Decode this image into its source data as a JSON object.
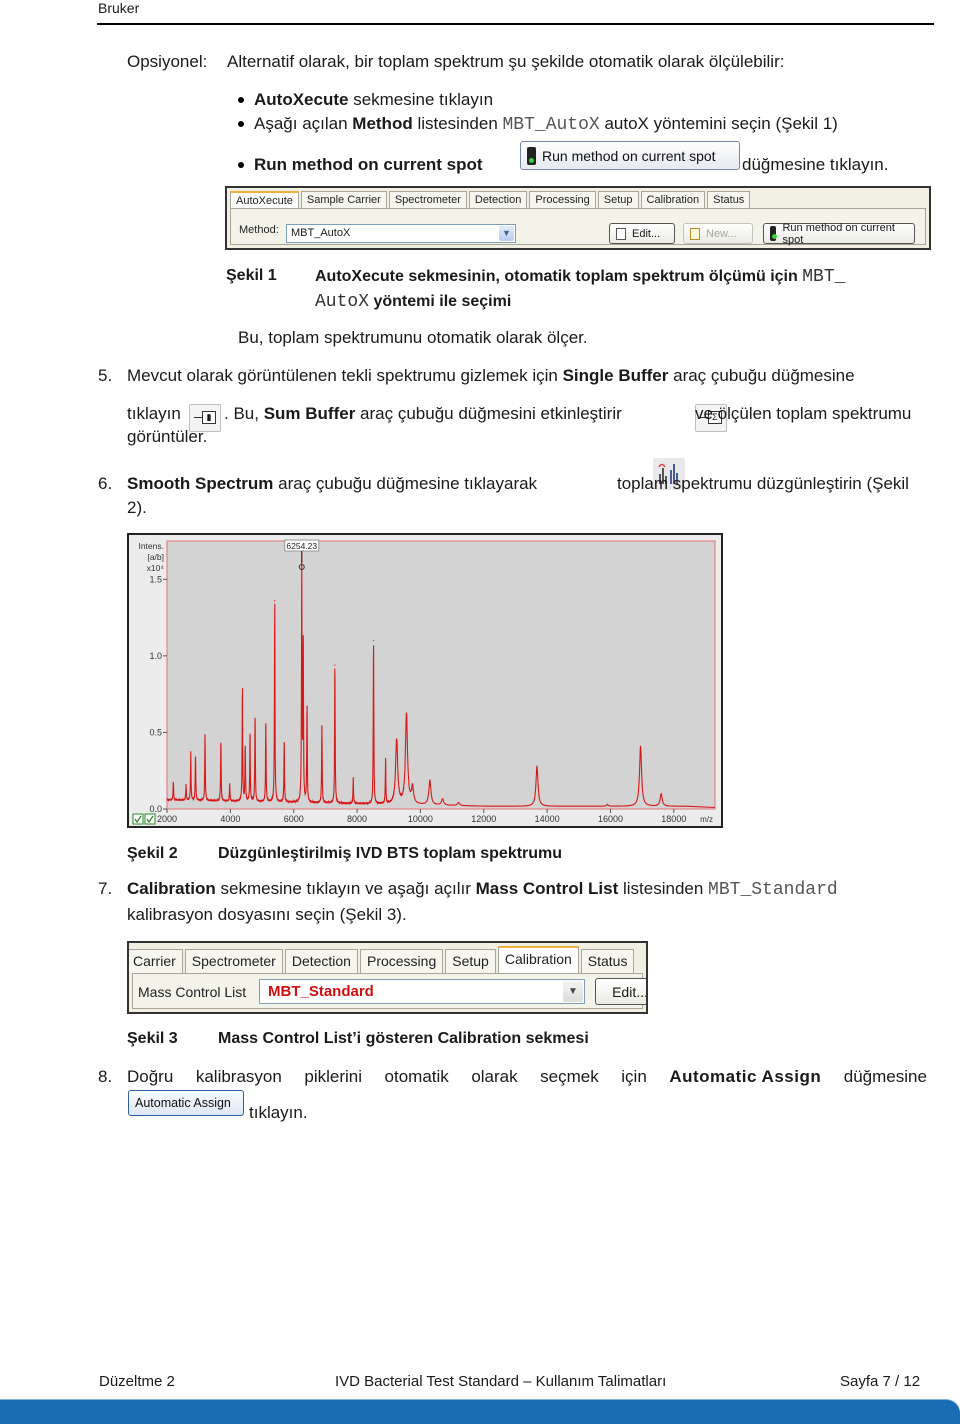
{
  "header": {
    "brand": "Bruker"
  },
  "optional": {
    "label": "Opsiyonel:",
    "text": "Alternatif olarak, bir toplam spektrum şu şekilde otomatik olarak ölçülebilir:",
    "bullets": [
      {
        "bold": "AutoXecute",
        "rest": " sekmesine tıklayın"
      },
      {
        "pre": "Aşağı açılan ",
        "bold": "Method",
        "mid": " listesinden ",
        "code": "MBT_AutoX",
        "rest": " autoX yöntemini seçin (Şekil 1)"
      },
      {
        "bold": "Run method on current spot",
        "button_label": "Run method on current spot",
        "rest": " düğmesine tıklayın."
      }
    ]
  },
  "figure1": {
    "tabs": [
      "AutoXecute",
      "Sample Carrier",
      "Spectrometer",
      "Detection",
      "Processing",
      "Setup",
      "Calibration",
      "Status"
    ],
    "active_tab": "AutoXecute",
    "method_label": "Method:",
    "method_value": "MBT_AutoX",
    "edit_button": "Edit...",
    "new_button": "New...",
    "run_button": "Run method on current spot",
    "caption_num": "Şekil 1",
    "caption_text_1": "AutoXecute sekmesinin, otomatik toplam spektrum ölçümü için ",
    "caption_code_1": "MBT_",
    "caption_code_2": "AutoX",
    "caption_text_2": " yöntemi ile seçimi"
  },
  "after_fig1": "Bu, toplam spektrumunu otomatik olarak ölçer.",
  "step5": {
    "num": "5.",
    "t1": "Mevcut olarak görüntülenen tekli spektrumu gizlemek için ",
    "b1": "Single Buffer",
    "t2": " araç çubuğu düğmesine",
    "t3": "tıklayın",
    "t4": ". Bu, ",
    "b2": "Sum Buffer",
    "t5": " araç çubuğu düğmesini etkinleştirir",
    "t6": "ve ölçülen toplam spektrumu",
    "t7": "görüntüler.",
    "icon_single": "single-buffer-icon",
    "icon_sum": "sum-buffer-icon"
  },
  "step6": {
    "num": "6.",
    "b1": "Smooth Spectrum",
    "t1": " araç çubuğu düğmesine tıklayarak",
    "t2": "toplam spektrumu düzgünleştirin (Şekil",
    "t3": "2).",
    "icon": "smooth-spectrum-icon"
  },
  "chart_data": {
    "type": "line",
    "title": "",
    "xlabel": "m/z",
    "ylabel": "Intens. [a/b] x10^4",
    "ylabel_lines": [
      "Intens.",
      "[a/b]",
      "x10⁴"
    ],
    "xlim": [
      2000,
      19300
    ],
    "ylim": [
      0,
      1.75
    ],
    "x_ticks": [
      2000,
      4000,
      6000,
      8000,
      10000,
      12000,
      14000,
      16000,
      18000
    ],
    "y_ticks": [
      "0.0",
      "0.5",
      "1.0",
      "1.5"
    ],
    "y_tick_values": [
      0,
      0.5,
      1.0,
      1.5
    ],
    "grid": false,
    "peak_annotation": {
      "x": 6254.23,
      "label": "6254.23"
    },
    "baseline": 0.05,
    "peaks": [
      {
        "x": 2200,
        "y": 0.14
      },
      {
        "x": 2600,
        "y": 0.12
      },
      {
        "x": 2750,
        "y": 0.34
      },
      {
        "x": 2900,
        "y": 0.31
      },
      {
        "x": 3200,
        "y": 0.45
      },
      {
        "x": 3700,
        "y": 0.42
      },
      {
        "x": 3980,
        "y": 0.13
      },
      {
        "x": 4380,
        "y": 0.78
      },
      {
        "x": 4470,
        "y": 0.38
      },
      {
        "x": 4620,
        "y": 0.47
      },
      {
        "x": 4780,
        "y": 0.58
      },
      {
        "x": 5120,
        "y": 0.53
      },
      {
        "x": 5400,
        "y": 1.36
      },
      {
        "x": 5700,
        "y": 0.43
      },
      {
        "x": 6254,
        "y": 1.62
      },
      {
        "x": 6300,
        "y": 1.08
      },
      {
        "x": 6420,
        "y": 0.66
      },
      {
        "x": 6890,
        "y": 0.53
      },
      {
        "x": 7300,
        "y": 0.94
      },
      {
        "x": 7880,
        "y": 0.19
      },
      {
        "x": 8520,
        "y": 1.1
      },
      {
        "x": 8900,
        "y": 0.31
      },
      {
        "x": 9250,
        "y": 0.44
      },
      {
        "x": 9560,
        "y": 0.61
      },
      {
        "x": 9750,
        "y": 0.13
      },
      {
        "x": 10300,
        "y": 0.18
      },
      {
        "x": 10700,
        "y": 0.06
      },
      {
        "x": 11200,
        "y": 0.04
      },
      {
        "x": 13680,
        "y": 0.28
      },
      {
        "x": 15900,
        "y": 0.03
      },
      {
        "x": 16950,
        "y": 0.41
      },
      {
        "x": 17600,
        "y": 0.1
      }
    ],
    "line_color": "#d81818",
    "background_color": "#d3d3d3"
  },
  "figure2": {
    "caption_num": "Şekil 2",
    "caption_text": "Düzgünleştirilmiş IVD BTS toplam spektrumu"
  },
  "step7": {
    "num": "7.",
    "b1": "Calibration",
    "t1": " sekmesine tıklayın ve aşağı açılır ",
    "b2": "Mass Control List",
    "t2": " listesinden ",
    "code": "MBT_Standard",
    "t3": "kalibrasyon dosyasını seçin (Şekil 3)."
  },
  "figure3": {
    "tabs": [
      "Carrier",
      "Spectrometer",
      "Detection",
      "Processing",
      "Setup",
      "Calibration",
      "Status"
    ],
    "active_tab": "Calibration",
    "list_label": "Mass Control List",
    "list_value": "MBT_Standard",
    "list_value_color": "#d01010",
    "edit_button": "Edit...",
    "caption_num": "Şekil 3",
    "caption_text": "Mass Control List’i gösteren Calibration sekmesi"
  },
  "step8": {
    "num": "8.",
    "words": [
      "Doğru",
      "kalibrasyon",
      "piklerini",
      "otomatik",
      "olarak",
      "seçmek",
      "için"
    ],
    "b1": "Automatic Assign",
    "t1": "düğmesine",
    "button_label": "Automatic Assign",
    "t2": "tıklayın."
  },
  "footer": {
    "left": "Düzeltme 2",
    "center": "IVD Bacterial Test Standard – Kullanım Talimatları",
    "right": "Sayfa 7 / 12",
    "band_color": "#1a6db3"
  }
}
